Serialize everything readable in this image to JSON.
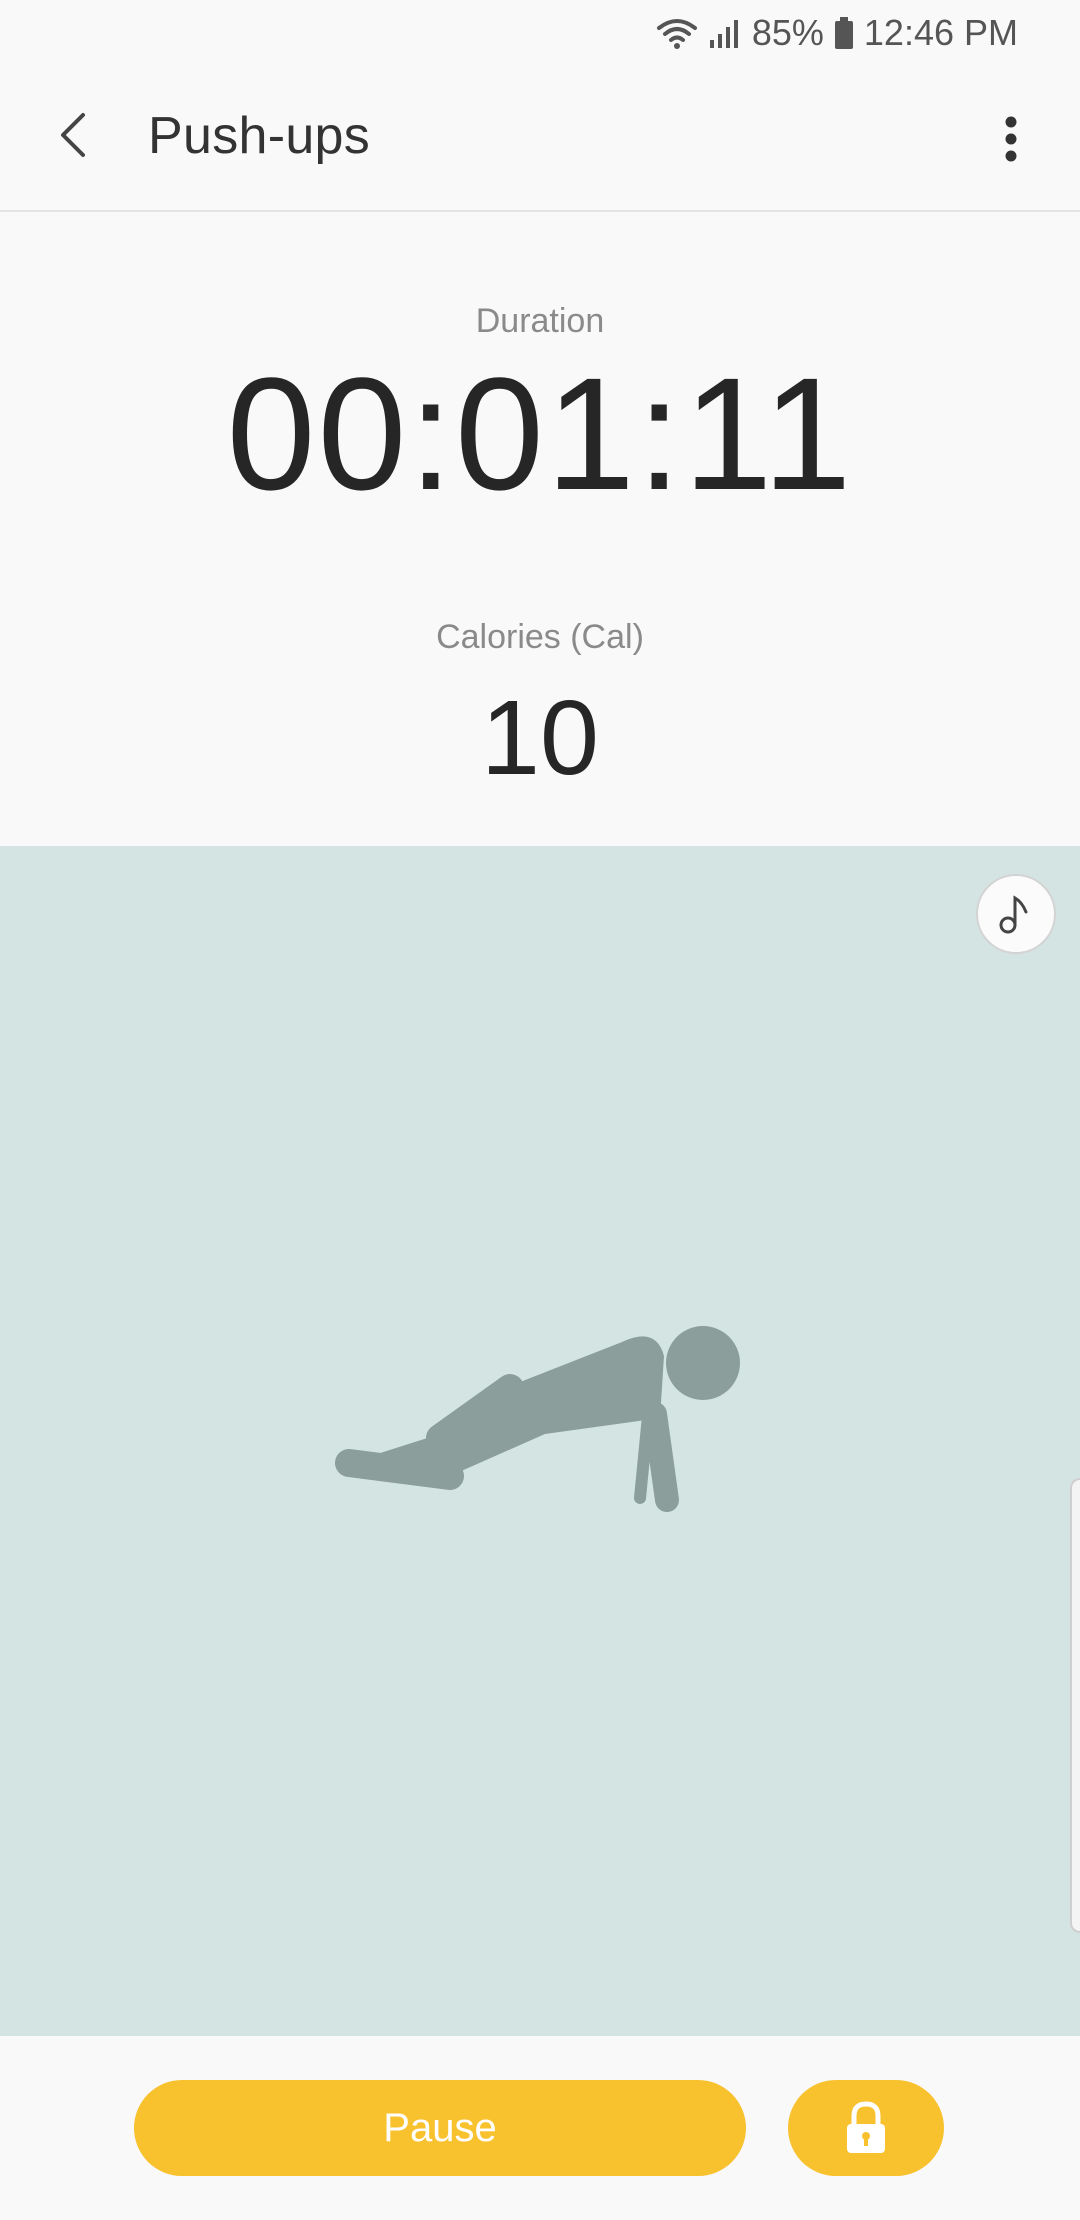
{
  "status_bar": {
    "battery": "85%",
    "time": "12:46 PM",
    "icons": [
      "wifi-icon",
      "signal-icon",
      "battery-icon"
    ]
  },
  "app_bar": {
    "title": "Push-ups",
    "icons": [
      "back-arrow-icon",
      "more-vert-icon"
    ]
  },
  "stats": {
    "duration_label": "Duration",
    "duration_value": "00:01:11",
    "calories_label": "Calories (Cal)",
    "calories_value": "10"
  },
  "illustration": {
    "icons": [
      "music-note-icon",
      "push-up-figure"
    ],
    "background": "#d4e4e2",
    "figure_color": "#8b9e9c"
  },
  "controls": {
    "pause_label": "Pause",
    "icons": [
      "lock-icon"
    ],
    "accent": "#f8c12e"
  }
}
